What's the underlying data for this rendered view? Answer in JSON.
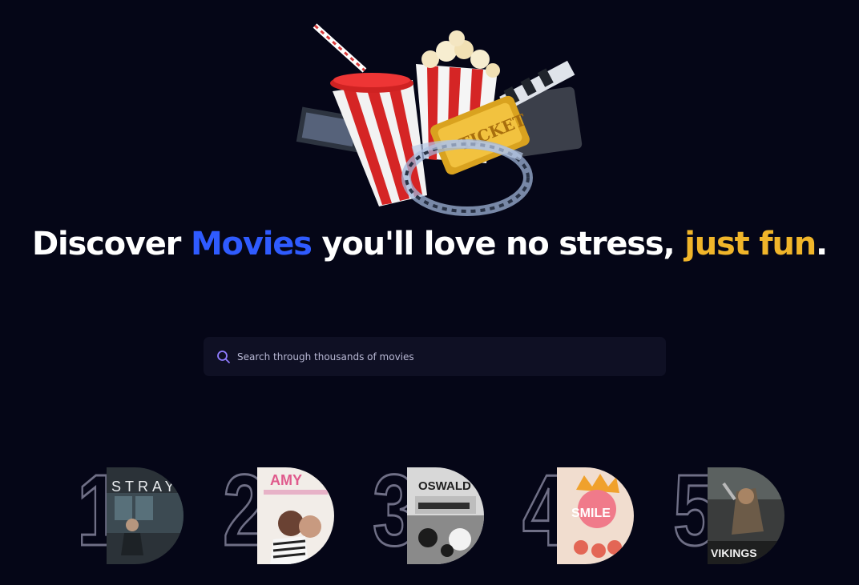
{
  "headline": {
    "part1": "Discover ",
    "highlight1": "Movies",
    "part2": " you'll love no stress, ",
    "highlight2": "just fun",
    "part3": "."
  },
  "search": {
    "placeholder": "Search through thousands of movies",
    "value": ""
  },
  "trending": [
    {
      "rank": "1",
      "poster_text": "STRAY",
      "poster_icon": "movie-poster-image"
    },
    {
      "rank": "2",
      "poster_text": "AMY",
      "poster_icon": "movie-poster-image"
    },
    {
      "rank": "3",
      "poster_text": "OSWALD",
      "poster_icon": "movie-poster-image"
    },
    {
      "rank": "4",
      "poster_text": "SMILE",
      "poster_icon": "movie-poster-image"
    },
    {
      "rank": "5",
      "poster_text": "VIKINGS",
      "poster_icon": "movie-poster-image"
    }
  ],
  "colors": {
    "background": "#050617",
    "accent_blue": "#2f5bff",
    "accent_gold": "#f0b52a",
    "search_bg": "#0f1024",
    "search_icon": "#8f7cff"
  }
}
